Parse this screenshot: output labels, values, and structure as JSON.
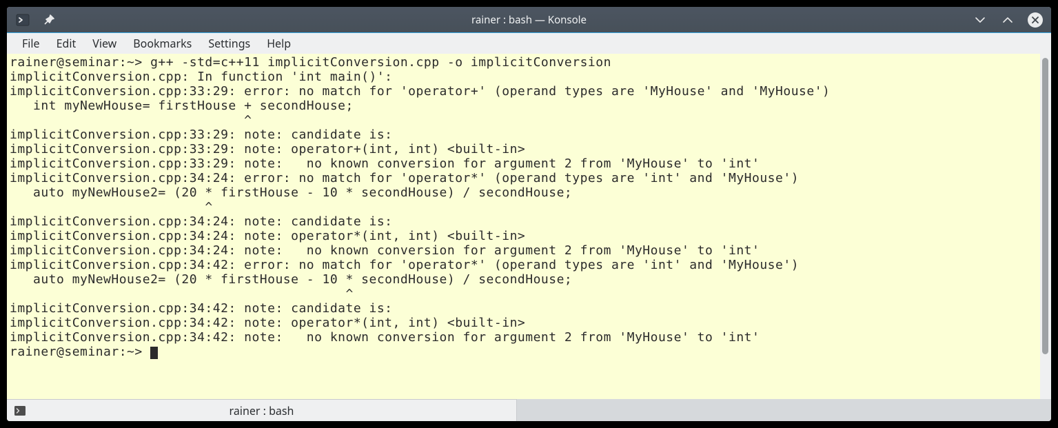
{
  "window": {
    "title": "rainer : bash — Konsole"
  },
  "menubar": {
    "file": "File",
    "edit": "Edit",
    "view": "View",
    "bookmarks": "Bookmarks",
    "settings": "Settings",
    "help": "Help"
  },
  "terminal": {
    "lines": [
      "rainer@seminar:~> g++ -std=c++11 implicitConversion.cpp -o implicitConversion",
      "implicitConversion.cpp: In function 'int main()':",
      "implicitConversion.cpp:33:29: error: no match for 'operator+' (operand types are 'MyHouse' and 'MyHouse')",
      "   int myNewHouse= firstHouse + secondHouse;",
      "                              ^",
      "implicitConversion.cpp:33:29: note: candidate is:",
      "implicitConversion.cpp:33:29: note: operator+(int, int) <built-in>",
      "implicitConversion.cpp:33:29: note:   no known conversion for argument 2 from 'MyHouse' to 'int'",
      "implicitConversion.cpp:34:24: error: no match for 'operator*' (operand types are 'int' and 'MyHouse')",
      "   auto myNewHouse2= (20 * firstHouse - 10 * secondHouse) / secondHouse;",
      "                         ^",
      "implicitConversion.cpp:34:24: note: candidate is:",
      "implicitConversion.cpp:34:24: note: operator*(int, int) <built-in>",
      "implicitConversion.cpp:34:24: note:   no known conversion for argument 2 from 'MyHouse' to 'int'",
      "implicitConversion.cpp:34:42: error: no match for 'operator*' (operand types are 'int' and 'MyHouse')",
      "   auto myNewHouse2= (20 * firstHouse - 10 * secondHouse) / secondHouse;",
      "                                           ^",
      "implicitConversion.cpp:34:42: note: candidate is:",
      "implicitConversion.cpp:34:42: note: operator*(int, int) <built-in>",
      "implicitConversion.cpp:34:42: note:   no known conversion for argument 2 from 'MyHouse' to 'int'"
    ],
    "prompt": "rainer@seminar:~> "
  },
  "tab": {
    "label": "rainer : bash"
  }
}
